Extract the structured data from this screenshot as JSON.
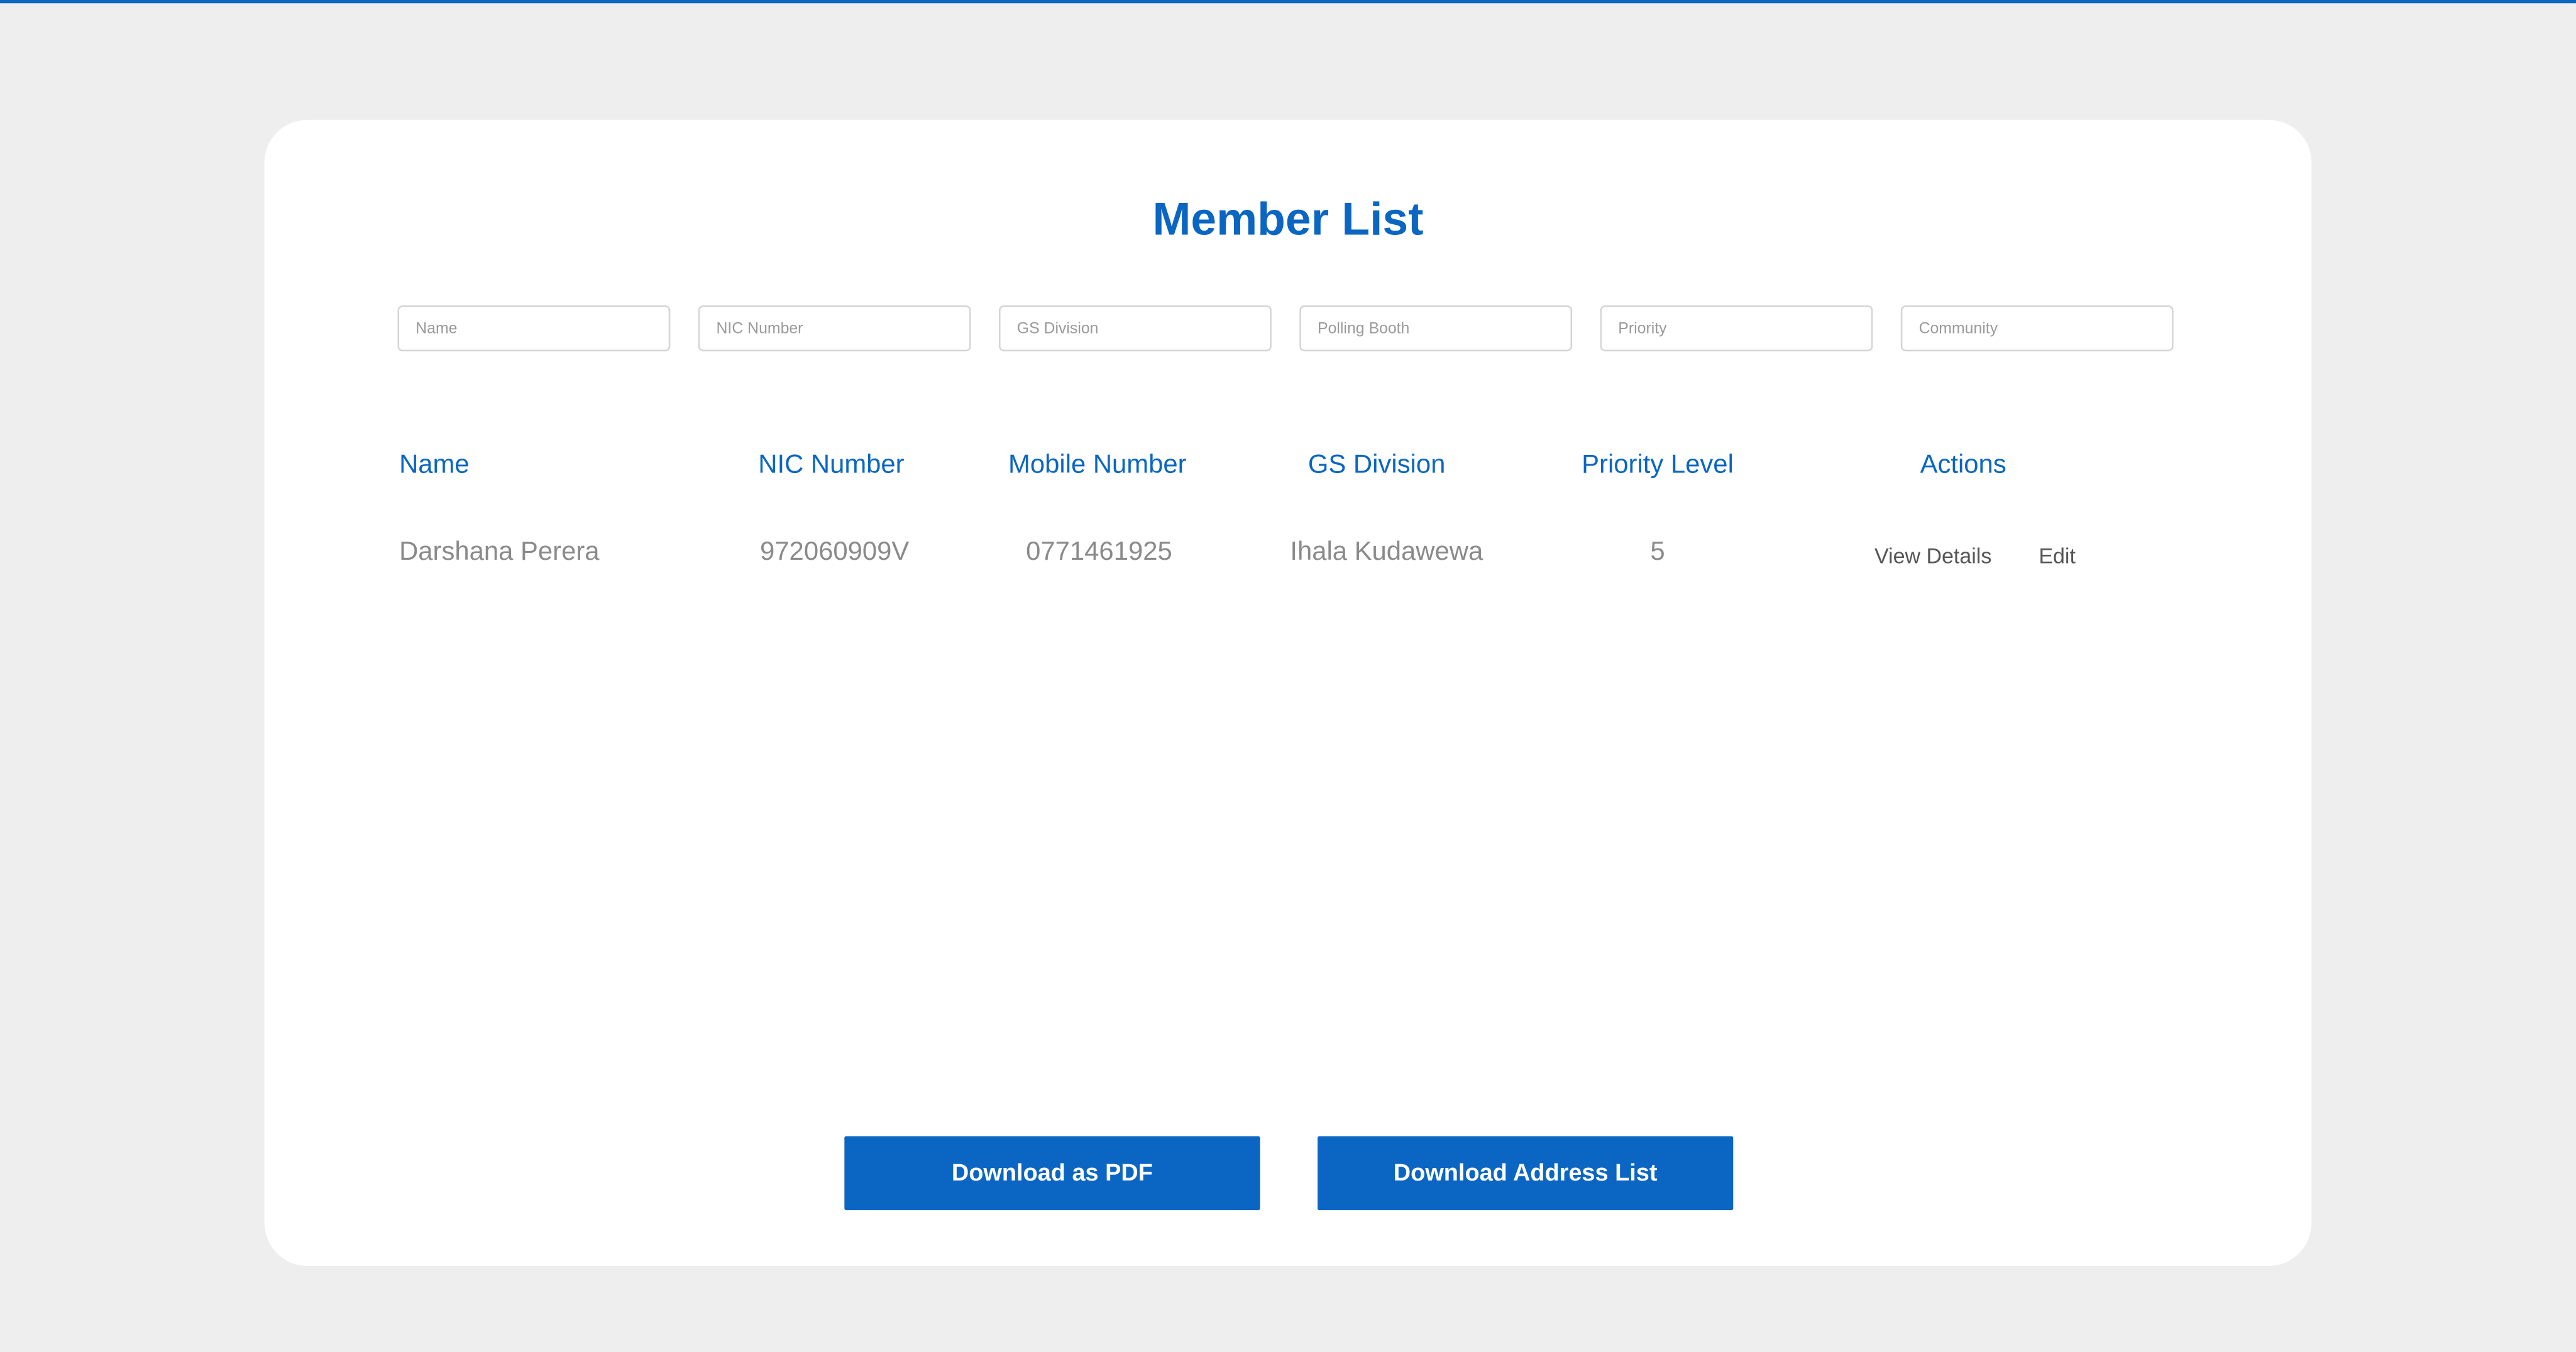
{
  "page": {
    "title": "Member List",
    "accent_color": "#0a66c2"
  },
  "filters": [
    {
      "placeholder": "Name",
      "value": ""
    },
    {
      "placeholder": "NIC Number",
      "value": ""
    },
    {
      "placeholder": "GS Division",
      "value": ""
    },
    {
      "placeholder": "Polling Booth",
      "value": ""
    },
    {
      "placeholder": "Priority",
      "value": ""
    },
    {
      "placeholder": "Community",
      "value": ""
    }
  ],
  "table": {
    "headers": [
      "Name",
      "NIC Number",
      "Mobile Number",
      "GS Division",
      "Priority Level",
      "Actions"
    ],
    "rows": [
      {
        "name": "Darshana Perera",
        "nic": "972060909V",
        "mobile": "0771461925",
        "gs_division": "Ihala Kudawewa",
        "priority": "5",
        "actions": {
          "view": "View Details",
          "edit": "Edit"
        }
      }
    ]
  },
  "buttons": {
    "download_pdf": "Download as PDF",
    "download_address": "Download Address List"
  }
}
